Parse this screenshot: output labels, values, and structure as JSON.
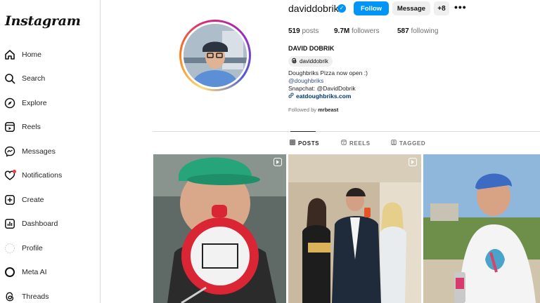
{
  "app": {
    "logo": "Instagram"
  },
  "sidebar": {
    "items": [
      {
        "label": "Home",
        "icon": "home-icon"
      },
      {
        "label": "Search",
        "icon": "search-icon"
      },
      {
        "label": "Explore",
        "icon": "compass-icon"
      },
      {
        "label": "Reels",
        "icon": "reels-icon"
      },
      {
        "label": "Messages",
        "icon": "messenger-icon"
      },
      {
        "label": "Notifications",
        "icon": "heart-icon"
      },
      {
        "label": "Create",
        "icon": "plus-square-icon"
      },
      {
        "label": "Dashboard",
        "icon": "dashboard-icon"
      },
      {
        "label": "Profile",
        "icon": "profile-avatar-icon"
      },
      {
        "label": "Meta AI",
        "icon": "meta-ai-icon"
      },
      {
        "label": "Threads",
        "icon": "threads-icon"
      }
    ]
  },
  "profile": {
    "username": "daviddobrik",
    "verified_mark": "✓",
    "follow_label": "Follow",
    "message_label": "Message",
    "adduser_glyph": "+8",
    "more_glyph": "•••",
    "posts_count": "519",
    "posts_label": "posts",
    "followers_count": "9.7M",
    "followers_label": "followers",
    "following_count": "587",
    "following_label": "following",
    "full_name": "DAVID DOBRIK",
    "threads_handle": "daviddobrik",
    "bio_line1": "Doughbriks Pizza now open :)",
    "bio_line2": "@doughbriks",
    "bio_line3": "Snapchat: @DavidDobrik",
    "website": "eatdoughbriks.com",
    "followed_by_prefix": "Followed by",
    "followed_by_user": "mrbeast"
  },
  "tabs": [
    {
      "label": "POSTS",
      "active": true
    },
    {
      "label": "REELS",
      "active": false
    },
    {
      "label": "TAGGED",
      "active": false
    }
  ],
  "colors": {
    "accent": "#0095f6",
    "notification": "#ff3040",
    "link": "#00376b"
  }
}
